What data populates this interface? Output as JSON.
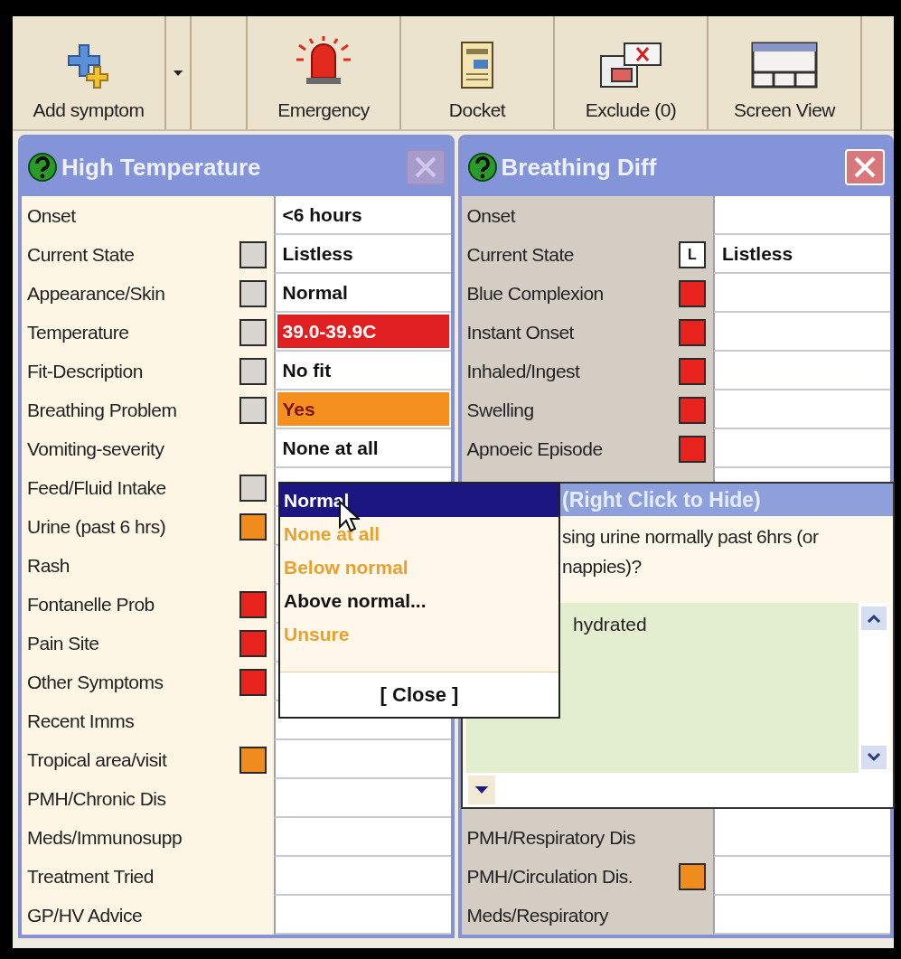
{
  "toolbar": {
    "buttons": [
      {
        "kind": "add",
        "label": "Add symptom",
        "split": true
      },
      {
        "kind": "emergency",
        "label": "Emergency",
        "split": false
      },
      {
        "kind": "docket",
        "label": "Docket",
        "split": false
      },
      {
        "kind": "exclude",
        "label": "Exclude (0)",
        "split": false
      },
      {
        "kind": "screen",
        "label": "Screen View",
        "split": false
      }
    ]
  },
  "panels": [
    {
      "title": "High Temperature",
      "selected": true,
      "close_disabled": true,
      "rows": [
        {
          "label": "Onset",
          "value": {
            "text": "<6 hours"
          }
        },
        {
          "label": "Current State",
          "flag": {
            "color": "#d9d5d0"
          },
          "value": {
            "text": "Listless"
          }
        },
        {
          "label": "Appearance/Skin",
          "flag": {
            "color": "#d9d5d0"
          },
          "value": {
            "text": "Normal"
          }
        },
        {
          "label": "Temperature",
          "flag": {
            "color": "#d9d5d0"
          },
          "value": {
            "text": "39.0-39.9C",
            "color": "#e02020"
          }
        },
        {
          "label": "Fit-Description",
          "flag": {
            "color": "#d9d5d0"
          },
          "value": {
            "text": "No fit"
          }
        },
        {
          "label": "Breathing Problem",
          "flag": {
            "color": "#d9d5d0"
          },
          "value": {
            "text": "Yes",
            "color": "#f5901e"
          }
        },
        {
          "label": "Vomiting-severity",
          "value": {
            "text": "None at all"
          }
        },
        {
          "label": "Feed/Fluid Intake",
          "flag": {
            "color": "#d9d5d0"
          }
        },
        {
          "label": "Urine (past 6 hrs)",
          "flag": {
            "color": "#f08c1e"
          }
        },
        {
          "label": "Rash"
        },
        {
          "label": "Fontanelle Prob",
          "flag": {
            "color": "#e8221c"
          }
        },
        {
          "label": "Pain Site",
          "flag": {
            "color": "#e8221c"
          }
        },
        {
          "label": "Other Symptoms",
          "flag": {
            "color": "#e8221c"
          }
        },
        {
          "label": "Recent Imms"
        },
        {
          "label": "Tropical area/visit",
          "flag": {
            "color": "#f08c1e"
          }
        },
        {
          "label": "PMH/Chronic Dis"
        },
        {
          "label": "Meds/Immunosupp"
        },
        {
          "label": "Treatment Tried"
        },
        {
          "label": "GP/HV Advice"
        }
      ]
    },
    {
      "title": "Breathing Diff",
      "selected": false,
      "close_disabled": false,
      "rows": [
        {
          "label": "Onset"
        },
        {
          "label": "Current State",
          "flag": {
            "color": "#ffffff",
            "text": "L"
          },
          "value": {
            "text": "Listless"
          }
        },
        {
          "label": "Blue Complexion",
          "flag": {
            "color": "#e8221c"
          }
        },
        {
          "label": "Instant Onset",
          "flag": {
            "color": "#e8221c"
          }
        },
        {
          "label": "Inhaled/Ingest",
          "flag": {
            "color": "#e8221c"
          }
        },
        {
          "label": "Swelling",
          "flag": {
            "color": "#e8221c"
          }
        },
        {
          "label": "Apnoeic Episode",
          "flag": {
            "color": "#e8221c"
          }
        }
      ],
      "rows_below_popup": [
        {
          "label": "PMH/Respiratory Dis"
        },
        {
          "label": "PMH/Circulation Dis.",
          "flag": {
            "color": "#f08c1e"
          }
        },
        {
          "label": "Meds/Respiratory"
        }
      ]
    }
  ],
  "help_popup": {
    "title": "(Right Click to Hide)",
    "question": "sing urine normally past 6hrs (or nappies)?",
    "answer": "hydrated"
  },
  "dropdown": {
    "options": [
      {
        "label": "Normal",
        "selected": true
      },
      {
        "label": "None at all",
        "selected": false,
        "color": "#e8a030"
      },
      {
        "label": "Below normal",
        "selected": false,
        "color": "#e8a030"
      },
      {
        "label": "Above normal...",
        "selected": false,
        "color": "#111111"
      },
      {
        "label": "Unsure",
        "selected": false,
        "color": "#e8a030"
      }
    ],
    "close_label": "[ Close ]"
  }
}
